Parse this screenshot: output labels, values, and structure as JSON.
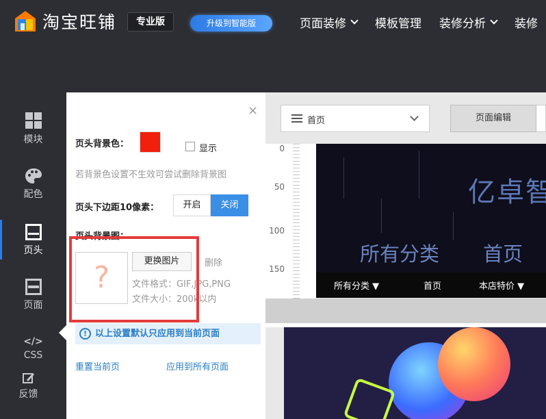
{
  "header": {
    "brand": "淘宝旺铺",
    "edition_badge": "专业版",
    "upgrade_button": "升级到智能版",
    "nav": [
      {
        "label": "页面装修",
        "has_dropdown": true
      },
      {
        "label": "模板管理",
        "has_dropdown": false
      },
      {
        "label": "装修分析",
        "has_dropdown": true
      },
      {
        "label": "装修",
        "has_dropdown": false
      }
    ]
  },
  "sidebar": {
    "items": [
      {
        "label": "模块",
        "icon": "grid-icon"
      },
      {
        "label": "配色",
        "icon": "palette-icon"
      },
      {
        "label": "页头",
        "icon": "header-icon",
        "active": true
      },
      {
        "label": "页面",
        "icon": "page-icon"
      },
      {
        "label": "CSS",
        "icon": "code-icon"
      },
      {
        "label": "反馈",
        "icon": "edit-icon"
      }
    ]
  },
  "panel": {
    "close": "×",
    "bg_color_label": "页头背景色：",
    "bg_color_value": "#f0200c",
    "show_label": "显示",
    "hint": "若背景色设置不生效可尝试删除背景图",
    "margin_label": "页头下边距10像素：",
    "toggle_on": "开启",
    "toggle_off": "关闭",
    "bg_image_label": "页头背景图：",
    "placeholder_glyph": "?",
    "change_image": "更换图片",
    "delete": "删除",
    "file_format": "文件格式：GIF,JPG,PNG",
    "file_size": "文件大小：200k以内",
    "notice": "以上设置默认只应用到当前页面",
    "reset_link": "重置当前页",
    "apply_all_link": "应用到所有页面"
  },
  "editor": {
    "page_select": "首页",
    "edit_tab": "页面编辑",
    "ruler_marks": [
      "0",
      "50",
      "100",
      "150"
    ],
    "banner_title": "亿卓智",
    "banner_links": [
      "所有分类",
      "首页"
    ],
    "nav_strip": [
      "所有分类 ▼",
      "首页",
      "本店特价 ▼"
    ]
  }
}
